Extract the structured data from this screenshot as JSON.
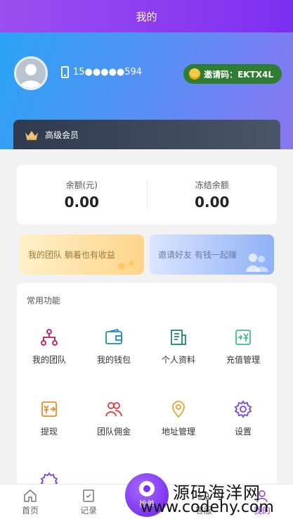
{
  "header": {
    "title": "我的"
  },
  "profile": {
    "phone": "15●●●●●594",
    "invite_code_label": "邀请码：EKTX4L"
  },
  "vip": {
    "label": "高级会员"
  },
  "balance": {
    "available_label": "余额(元)",
    "available_value": "0.00",
    "frozen_label": "冻结余额",
    "frozen_value": "0.00"
  },
  "promos": {
    "team": "我的团队 躺着也有收益",
    "invite": "邀请好友 有钱一起赚"
  },
  "functions": {
    "title": "常用功能",
    "items": [
      {
        "label": "我的团队",
        "icon": "team-tree-icon",
        "color": "#c2185b"
      },
      {
        "label": "我的钱包",
        "icon": "wallet-icon",
        "color": "#1e88c7"
      },
      {
        "label": "个人资料",
        "icon": "profile-doc-icon",
        "color": "#1b8a6b"
      },
      {
        "label": "充值管理",
        "icon": "recharge-icon",
        "color": "#3bbf8f"
      },
      {
        "label": "提现",
        "icon": "withdraw-icon",
        "color": "#f08a24"
      },
      {
        "label": "团队佣金",
        "icon": "team-commission-icon",
        "color": "#e53935"
      },
      {
        "label": "地址管理",
        "icon": "location-pin-icon",
        "color": "#f0a030"
      },
      {
        "label": "设置",
        "icon": "gear-icon",
        "color": "#7b3fe4"
      }
    ]
  },
  "tabbar": {
    "items": [
      {
        "label": "首页",
        "icon": "home-icon"
      },
      {
        "label": "记录",
        "icon": "record-icon"
      },
      {
        "label": "抢单",
        "icon": "grab-order-icon"
      },
      {
        "label": "客服",
        "icon": "service-icon"
      },
      {
        "label": "我的",
        "icon": "user-icon"
      }
    ],
    "active_color": "#8a3cf0"
  },
  "watermark": {
    "line1": "源码海洋网",
    "line2": "www.codehy.com"
  }
}
